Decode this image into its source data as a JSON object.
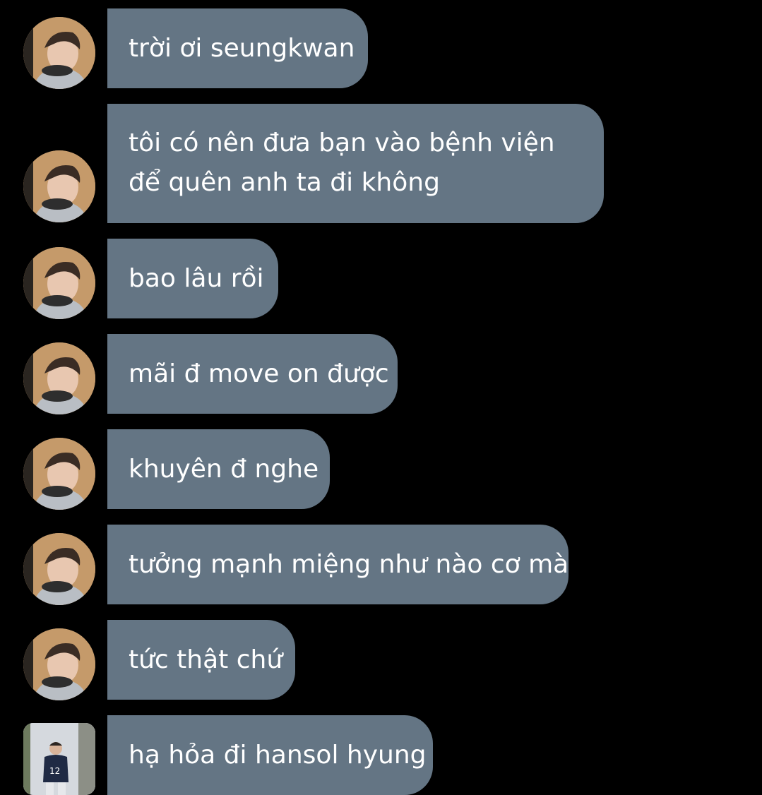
{
  "messages": [
    {
      "text": "trời ơi seungkwan",
      "avatar": "person-with-headphones-avatar"
    },
    {
      "text": "tôi có nên đưa bạn vào bệnh viện để quên anh ta đi không",
      "avatar": "person-with-headphones-avatar"
    },
    {
      "text": "bao lâu rồi",
      "avatar": "person-with-headphones-avatar"
    },
    {
      "text": "mãi đ move on được",
      "avatar": "person-with-headphones-avatar"
    },
    {
      "text": "khuyên đ nghe",
      "avatar": "person-with-headphones-avatar"
    },
    {
      "text": "tưởng mạnh miệng như nào cơ mà",
      "avatar": "person-with-headphones-avatar"
    },
    {
      "text": "tức thật chứ",
      "avatar": "person-with-headphones-avatar"
    },
    {
      "text": "hạ hỏa đi hansol hyung",
      "avatar": "person-in-jersey-avatar"
    }
  ],
  "colors": {
    "background": "#000000",
    "bubble": "#647584",
    "text": "#ffffff"
  }
}
